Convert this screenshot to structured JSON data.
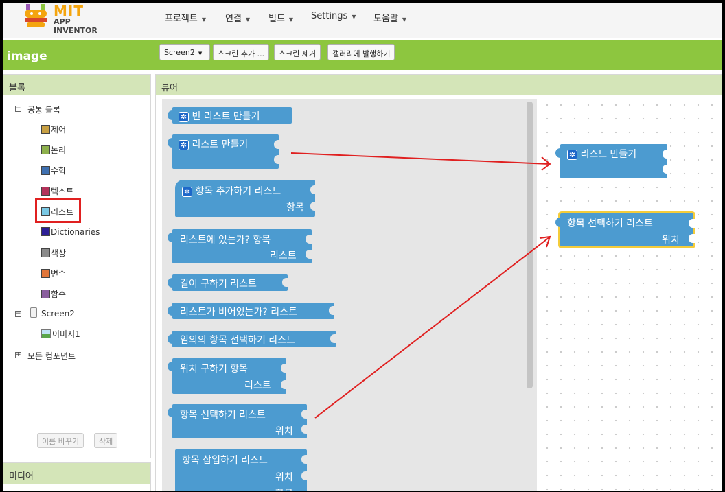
{
  "app": {
    "logo_title": "MIT",
    "logo_subtitle": "APP INVENTOR",
    "menu": [
      "프로젝트",
      "연결",
      "빌드",
      "Settings",
      "도움말"
    ],
    "project_name": "image",
    "toolbar": [
      "Screen2",
      "스크린 추가 ...",
      "스크린 제거",
      "갤러리에 발행하기"
    ]
  },
  "blocks_panel": {
    "title": "블록",
    "builtin": "공통 블록",
    "categories": [
      {
        "label": "제어",
        "color": "#c8a043"
      },
      {
        "label": "논리",
        "color": "#8db04c"
      },
      {
        "label": "수학",
        "color": "#3f70b0"
      },
      {
        "label": "텍스트",
        "color": "#b3325a"
      },
      {
        "label": "리스트",
        "color": "#79c8e4"
      },
      {
        "label": "Dictionaries",
        "color": "#2d1f96"
      },
      {
        "label": "색상",
        "color": "#8a8a8a"
      },
      {
        "label": "변수",
        "color": "#e1763a"
      },
      {
        "label": "함수",
        "color": "#8a5e9e"
      }
    ],
    "screen": "Screen2",
    "component": "이미지1",
    "any_component": "모든 컴포넌트",
    "rename_button": "이름 바꾸기",
    "delete_button": "삭제"
  },
  "media_panel": {
    "title": "미디어"
  },
  "viewer": {
    "title": "뷰어",
    "flyout_blocks": {
      "create_empty_list": "빈 리스트 만들기",
      "make_a_list": "리스트 만들기",
      "add_items": "항목 추가하기 리스트",
      "add_items_item": "항목",
      "is_in_list": "리스트에 있는가?   항목",
      "is_in_list_list": "리스트",
      "length": "길이 구하기 리스트",
      "is_empty": "리스트가 비어있는가? 리스트",
      "pick_random": "임의의 항목 선택하기 리스트",
      "index_in_list": "위치 구하기    항목",
      "index_in_list_list": "리스트",
      "select_item": "항목 선택하기    리스트",
      "select_item_index": "위치",
      "insert_item": "항목 삽입하기    리스트",
      "insert_item_index": "위치",
      "insert_item_item": "항목"
    },
    "workspace_blocks": {
      "make_a_list": "리스트 만들기",
      "select_item": "항목 선택하기     리스트",
      "select_item_index": "위치"
    },
    "annotation_color": "#e02020"
  }
}
